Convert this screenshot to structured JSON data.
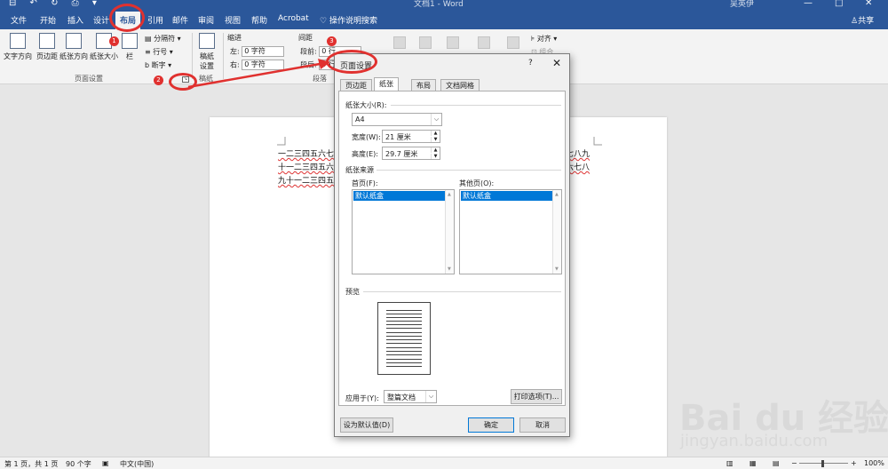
{
  "titlebar": {
    "quick_access": "⊟ ↶ ↻ ⎙ ▾",
    "doc_title": "文档1 - Word",
    "user": "吴英伊"
  },
  "tabs": [
    {
      "label": "文件"
    },
    {
      "label": "开始"
    },
    {
      "label": "插入"
    },
    {
      "label": "设计"
    },
    {
      "label": "布局"
    },
    {
      "label": "引用"
    },
    {
      "label": "邮件"
    },
    {
      "label": "审阅"
    },
    {
      "label": "视图"
    },
    {
      "label": "帮助"
    },
    {
      "label": "Acrobat"
    }
  ],
  "tell_me": "操作说明搜索",
  "share": "共享",
  "ribbon": {
    "page_setup": {
      "text_direction": "文字方向",
      "margins": "页边距",
      "orientation": "纸张方向",
      "size": "纸张大小",
      "columns": "栏",
      "breaks": "分隔符",
      "line_numbers": "行号",
      "hyphenation": "断字",
      "group_label": "页面设置"
    },
    "manuscript": {
      "label_line1": "稿纸",
      "label_line2": "设置",
      "group_label": "稿纸"
    },
    "indent": {
      "title": "缩进",
      "left_label": "左:",
      "left_value": "0 字符",
      "right_label": "右:",
      "right_value": "0 字符"
    },
    "spacing": {
      "title": "间距",
      "before_label": "段前:",
      "before_value": "0 行",
      "after_label": "段后:",
      "after_value": "0 行",
      "group_label": "段落"
    },
    "align": "对齐",
    "group": "组合"
  },
  "document": {
    "lines": [
      "一二三四五六七八九十一二三四五六七八九十一二三四五六七八九十一二三四五六七八九",
      "十一二三四五六七八九十一二三四五六七八九十一二三四五六七八九十一二三四五六七八",
      "九十一二三四五六七八九十"
    ]
  },
  "status": {
    "page": "第 1 页，共 1 页",
    "words": "90 个字",
    "language": "中文(中国)",
    "zoom": "100%"
  },
  "dialog": {
    "title": "页面设置",
    "help": "?",
    "close": "✕",
    "tabs": [
      "页边距",
      "纸张",
      "布局",
      "文档网格"
    ],
    "active_tab": 1,
    "paper_size_label": "纸张大小(R):",
    "paper_size_value": "A4",
    "width_label": "宽度(W):",
    "width_value": "21 厘米",
    "height_label": "高度(E):",
    "height_value": "29.7 厘米",
    "paper_source_label": "纸张来源",
    "first_page_label": "首页(F):",
    "other_pages_label": "其他页(O):",
    "first_page_item": "默认纸盒",
    "other_pages_item": "默认纸盒",
    "preview_label": "预览",
    "apply_to_label": "应用于(Y):",
    "apply_to_value": "整篇文档",
    "print_options": "打印选项(T)...",
    "set_default": "设为默认值(D)",
    "ok": "确定",
    "cancel": "取消"
  },
  "annotations": {
    "step1": "1",
    "step2": "2",
    "step3": "3",
    "color": "#e0312f"
  },
  "watermark": {
    "brand": "Bai du 经验",
    "url": "jingyan.baidu.com"
  }
}
